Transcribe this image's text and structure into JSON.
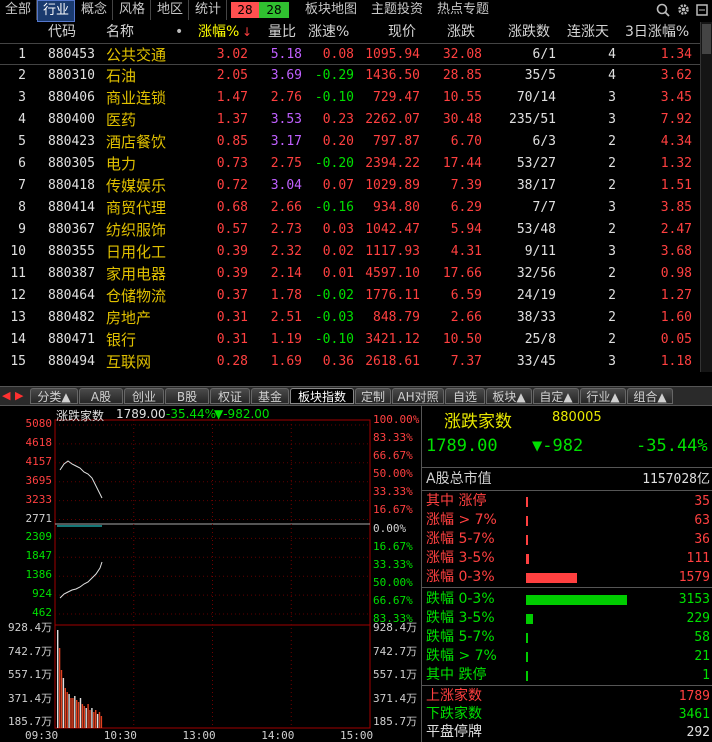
{
  "top_tabs": [
    "全部",
    "行业",
    "概念",
    "风格",
    "地区",
    "统计"
  ],
  "top_counts": {
    "up": "28",
    "down": "28"
  },
  "top_links": [
    "板块地图",
    "主题投资",
    "热点专题"
  ],
  "columns": [
    "代码",
    "名称",
    "涨幅%",
    "量比",
    "涨速%",
    "现价",
    "涨跌",
    "涨跌数",
    "连涨天",
    "3日涨幅%"
  ],
  "sort_indicator": "↓",
  "name_dot": "•",
  "rows": [
    {
      "idx": "1",
      "code": "880453",
      "name": "公共交通",
      "chg": "3.02",
      "vr": "5.18",
      "vr_hi": true,
      "spd": "0.08",
      "price": "1095.94",
      "diff": "32.08",
      "ud": "6/1",
      "days": "4",
      "chg3": "1.34",
      "spd_neg": false
    },
    {
      "idx": "2",
      "code": "880310",
      "name": "石油",
      "chg": "2.05",
      "vr": "3.69",
      "vr_hi": true,
      "spd": "-0.29",
      "price": "1436.50",
      "diff": "28.85",
      "ud": "35/5",
      "days": "4",
      "chg3": "3.62",
      "spd_neg": true
    },
    {
      "idx": "3",
      "code": "880406",
      "name": "商业连锁",
      "chg": "1.47",
      "vr": "2.76",
      "vr_hi": false,
      "spd": "-0.10",
      "price": "729.47",
      "diff": "10.55",
      "ud": "70/14",
      "days": "3",
      "chg3": "3.45",
      "spd_neg": true
    },
    {
      "idx": "4",
      "code": "880400",
      "name": "医药",
      "chg": "1.37",
      "vr": "3.53",
      "vr_hi": true,
      "spd": "0.23",
      "price": "2262.07",
      "diff": "30.48",
      "ud": "235/51",
      "days": "3",
      "chg3": "7.92",
      "spd_neg": false
    },
    {
      "idx": "5",
      "code": "880423",
      "name": "酒店餐饮",
      "chg": "0.85",
      "vr": "3.17",
      "vr_hi": true,
      "spd": "0.20",
      "price": "797.87",
      "diff": "6.70",
      "ud": "6/3",
      "days": "2",
      "chg3": "4.34",
      "spd_neg": false
    },
    {
      "idx": "6",
      "code": "880305",
      "name": "电力",
      "chg": "0.73",
      "vr": "2.75",
      "vr_hi": false,
      "spd": "-0.20",
      "price": "2394.22",
      "diff": "17.44",
      "ud": "53/27",
      "days": "2",
      "chg3": "1.32",
      "spd_neg": true
    },
    {
      "idx": "7",
      "code": "880418",
      "name": "传媒娱乐",
      "chg": "0.72",
      "vr": "3.04",
      "vr_hi": true,
      "spd": "0.07",
      "price": "1029.89",
      "diff": "7.39",
      "ud": "38/17",
      "days": "2",
      "chg3": "1.51",
      "spd_neg": false
    },
    {
      "idx": "8",
      "code": "880414",
      "name": "商贸代理",
      "chg": "0.68",
      "vr": "2.66",
      "vr_hi": false,
      "spd": "-0.16",
      "price": "934.80",
      "diff": "6.29",
      "ud": "7/7",
      "days": "3",
      "chg3": "3.85",
      "spd_neg": true
    },
    {
      "idx": "9",
      "code": "880367",
      "name": "纺织服饰",
      "chg": "0.57",
      "vr": "2.73",
      "vr_hi": false,
      "spd": "0.03",
      "price": "1042.47",
      "diff": "5.94",
      "ud": "53/48",
      "days": "2",
      "chg3": "2.47",
      "spd_neg": false
    },
    {
      "idx": "10",
      "code": "880355",
      "name": "日用化工",
      "chg": "0.39",
      "vr": "2.32",
      "vr_hi": false,
      "spd": "0.02",
      "price": "1117.93",
      "diff": "4.31",
      "ud": "9/11",
      "days": "3",
      "chg3": "3.68",
      "spd_neg": false
    },
    {
      "idx": "11",
      "code": "880387",
      "name": "家用电器",
      "chg": "0.39",
      "vr": "2.14",
      "vr_hi": false,
      "spd": "0.01",
      "price": "4597.10",
      "diff": "17.66",
      "ud": "32/56",
      "days": "2",
      "chg3": "0.98",
      "spd_neg": false
    },
    {
      "idx": "12",
      "code": "880464",
      "name": "仓储物流",
      "chg": "0.37",
      "vr": "1.78",
      "vr_hi": false,
      "spd": "-0.02",
      "price": "1776.11",
      "diff": "6.59",
      "ud": "24/19",
      "days": "2",
      "chg3": "1.27",
      "spd_neg": true
    },
    {
      "idx": "13",
      "code": "880482",
      "name": "房地产",
      "chg": "0.31",
      "vr": "2.51",
      "vr_hi": false,
      "spd": "-0.03",
      "price": "848.79",
      "diff": "2.66",
      "ud": "38/33",
      "days": "2",
      "chg3": "1.60",
      "spd_neg": true
    },
    {
      "idx": "14",
      "code": "880471",
      "name": "银行",
      "chg": "0.31",
      "vr": "1.19",
      "vr_hi": false,
      "spd": "-0.10",
      "price": "3421.12",
      "diff": "10.50",
      "ud": "25/8",
      "days": "2",
      "chg3": "0.05",
      "spd_neg": true
    },
    {
      "idx": "15",
      "code": "880494",
      "name": "互联网",
      "chg": "0.28",
      "vr": "1.69",
      "vr_hi": false,
      "spd": "0.36",
      "price": "2618.61",
      "diff": "7.37",
      "ud": "33/45",
      "days": "3",
      "chg3": "1.18",
      "spd_neg": false
    }
  ],
  "bottom_tabs": [
    "分类▲",
    "A股",
    "创业",
    "B股",
    "权证",
    "基金",
    "板块指数",
    "定制",
    "AH对照",
    "自选",
    "板块▲",
    "自定▲",
    "行业▲",
    "组合▲"
  ],
  "bottom_active": 6,
  "chart": {
    "title": "涨跌家数",
    "last": "1789.00",
    "chg": "-35.44%",
    "diff": "▼-982.00",
    "left_price_ticks": [
      "5080",
      "4618",
      "4157",
      "3695",
      "3233",
      "2771",
      "2309",
      "1847",
      "1386",
      "924",
      "462"
    ],
    "right_pct_ticks": [
      "100.00%",
      "83.33%",
      "66.67%",
      "50.00%",
      "33.33%",
      "16.67%",
      "0.00%",
      "16.67%",
      "33.33%",
      "50.00%",
      "66.67%",
      "83.33%"
    ],
    "left_vol_ticks": [
      "928.4万",
      "742.7万",
      "557.1万",
      "371.4万",
      "185.7万"
    ],
    "right_vol_ticks": [
      "928.4万",
      "742.7万",
      "557.1万",
      "371.4万",
      "185.7万"
    ],
    "time_ticks": [
      "09:30",
      "10:30",
      "13:00",
      "14:00",
      "15:00"
    ]
  },
  "panel": {
    "title": "涨跌家数",
    "code": "880005",
    "value": "1789.00",
    "diff": "▼-982",
    "pct": "-35.44%",
    "mktcap_label": "A股总市值",
    "mktcap": "1157028亿",
    "up_rows": [
      {
        "label": "其中 涨停",
        "val": "35",
        "frac": 0.006
      },
      {
        "label": "涨幅 > 7%",
        "val": "63",
        "frac": 0.012
      },
      {
        "label": "涨幅 5-7%",
        "val": "36",
        "frac": 0.007
      },
      {
        "label": "涨幅 3-5%",
        "val": "111",
        "frac": 0.021
      },
      {
        "label": "涨幅 0-3%",
        "val": "1579",
        "frac": 0.32
      }
    ],
    "down_rows": [
      {
        "label": "跌幅 0-3%",
        "val": "3153",
        "frac": 0.63
      },
      {
        "label": "跌幅 3-5%",
        "val": "229",
        "frac": 0.044
      },
      {
        "label": "跌幅 5-7%",
        "val": "58",
        "frac": 0.011
      },
      {
        "label": "跌幅 > 7%",
        "val": "21",
        "frac": 0.004
      },
      {
        "label": "其中 跌停",
        "val": "1",
        "frac": 0.0
      }
    ],
    "summary": [
      {
        "label": "上涨家数",
        "val": "1789"
      },
      {
        "label": "下跌家数",
        "val": "3461"
      },
      {
        "label": "平盘停牌",
        "val": "292"
      }
    ]
  },
  "colors": {
    "up": "#ff4040",
    "down": "#00e000",
    "name": "#e0c000",
    "purple": "#c060ff",
    "accent": "#1a3a6e"
  }
}
